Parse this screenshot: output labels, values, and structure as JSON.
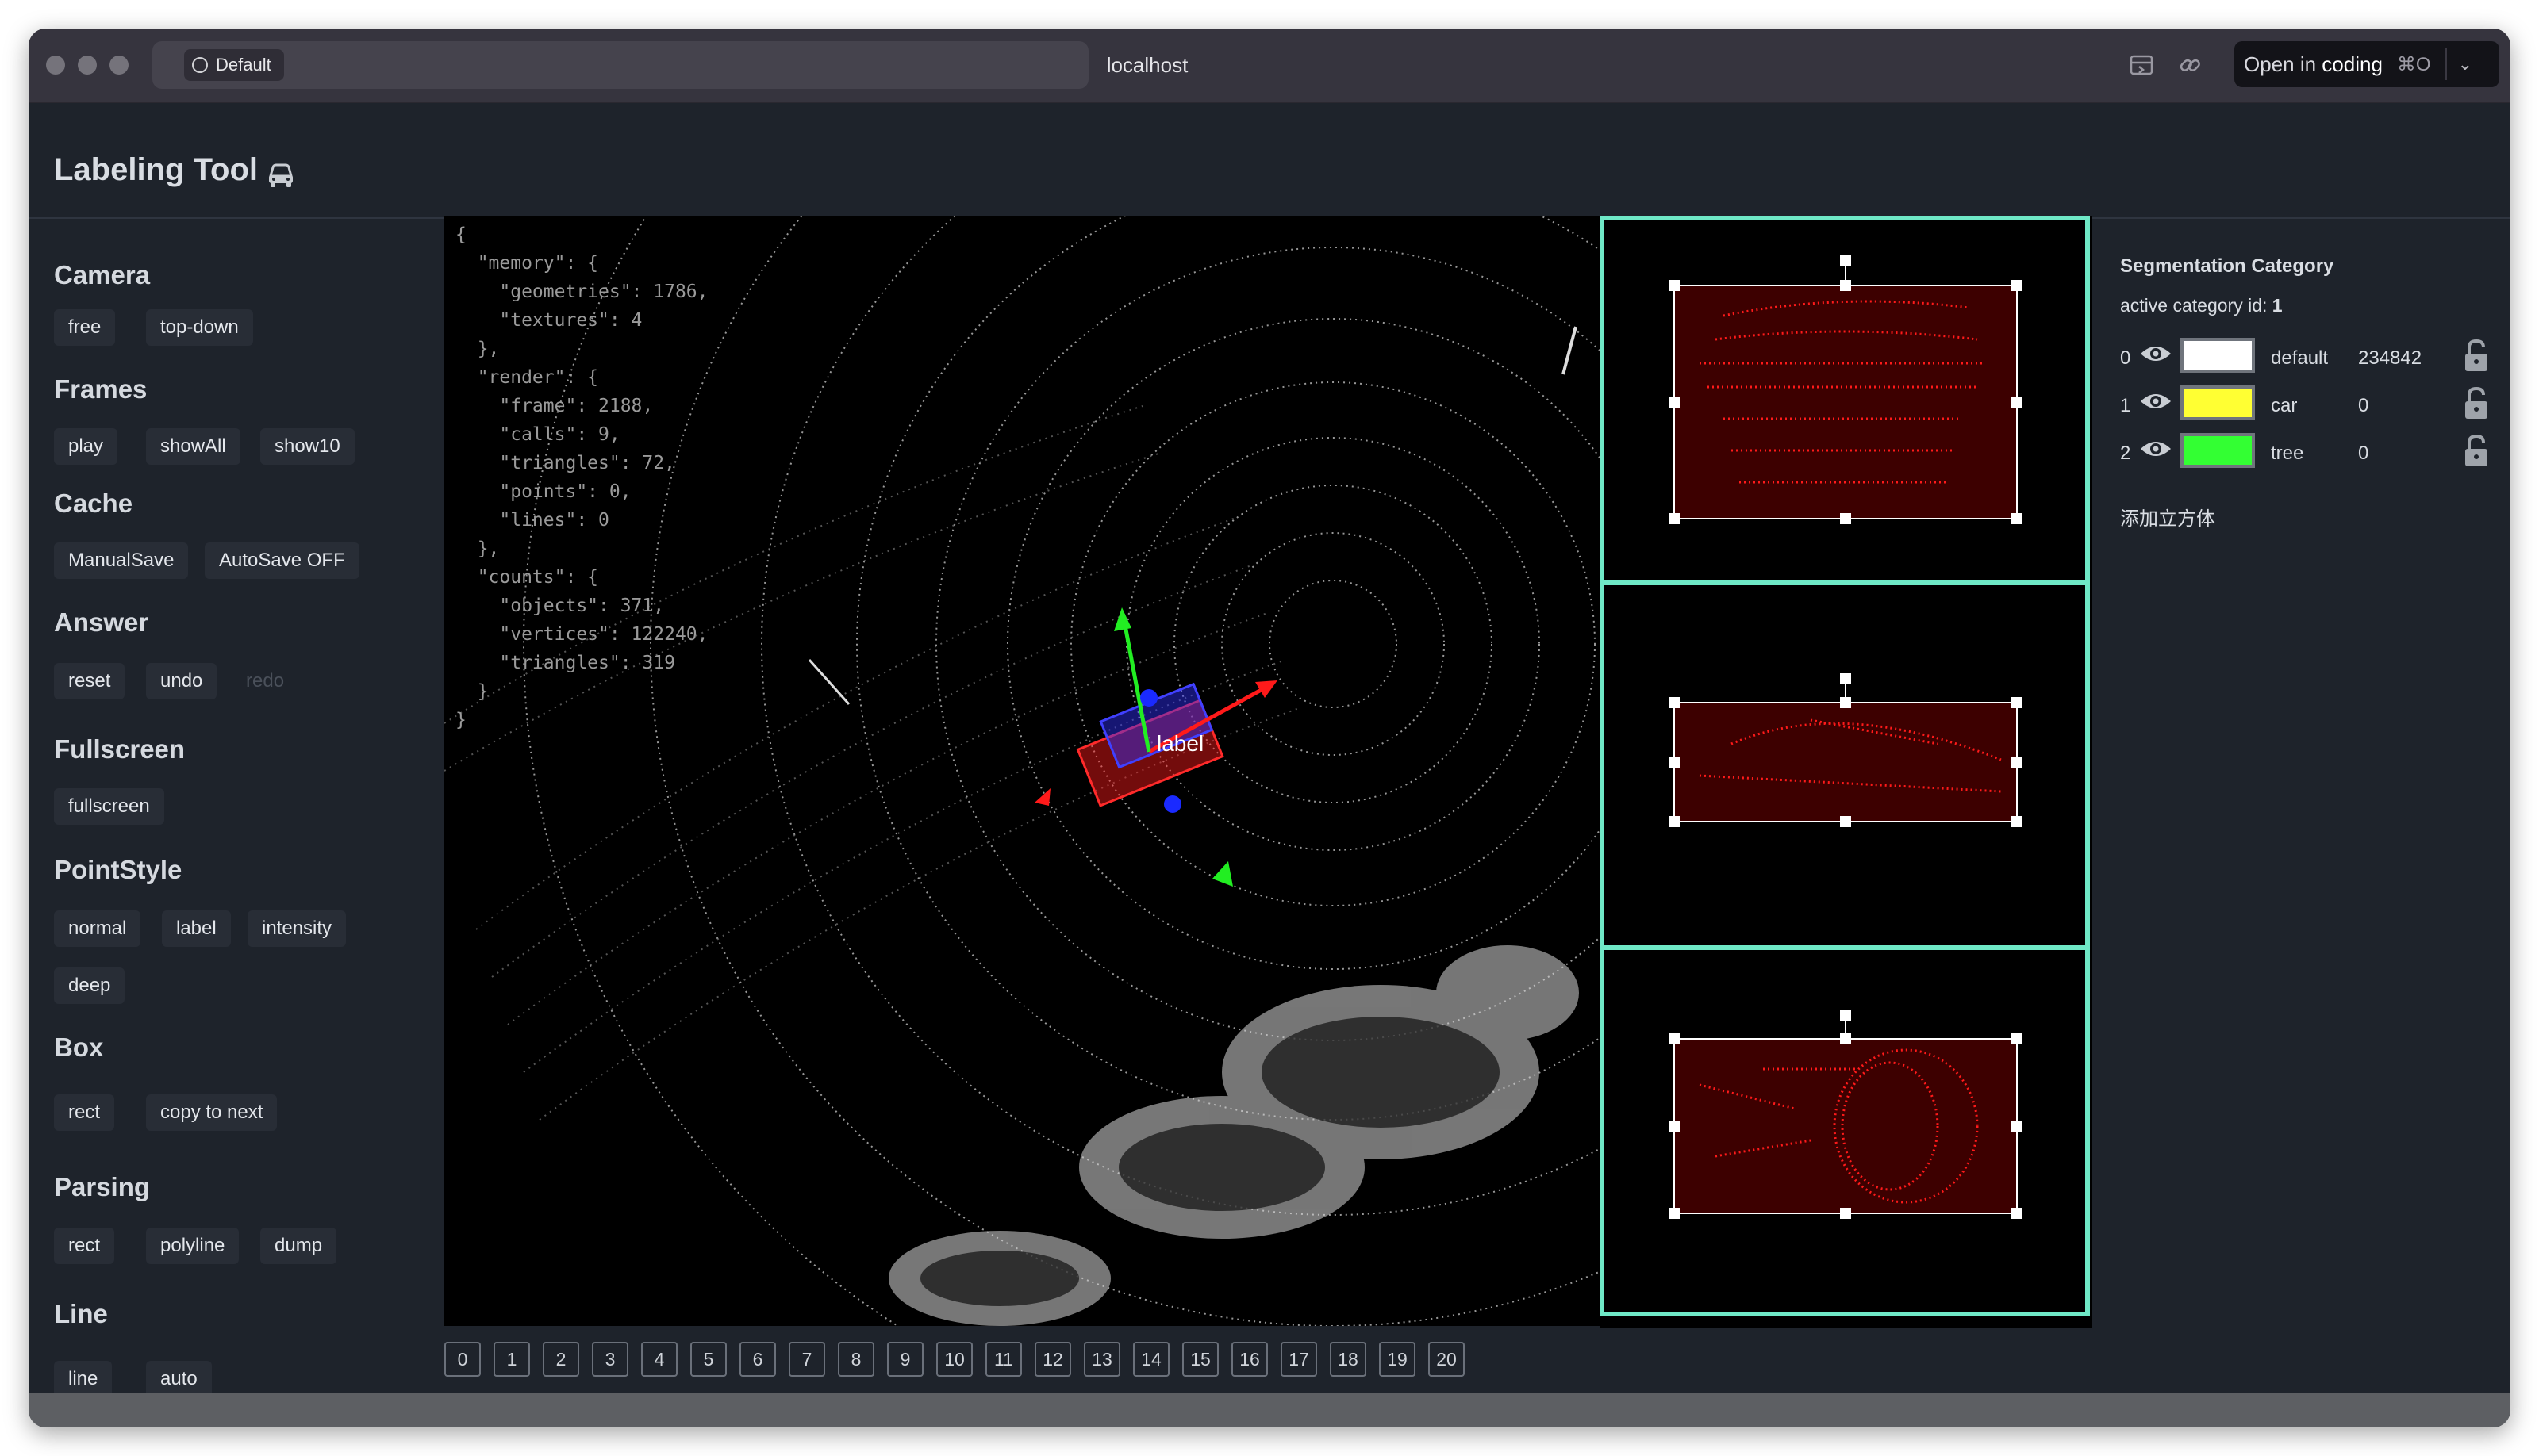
{
  "browser": {
    "profile_label": "Default",
    "url": "localhost",
    "open_button": {
      "prefix": "Open in ",
      "app": "coding",
      "shortcut": "⌘O"
    }
  },
  "app": {
    "title": "Labeling Tool",
    "icon": "car-icon"
  },
  "sidebar": {
    "sections": [
      {
        "title": "Camera",
        "buttons": [
          "free",
          "top-down"
        ]
      },
      {
        "title": "Frames",
        "buttons": [
          "play",
          "showAll",
          "show10"
        ]
      },
      {
        "title": "Cache",
        "buttons": [
          "ManualSave",
          "AutoSave OFF"
        ]
      },
      {
        "title": "Answer",
        "buttons": [
          "reset",
          "undo",
          "redo"
        ],
        "disabled": [
          "redo"
        ]
      },
      {
        "title": "Fullscreen",
        "buttons": [
          "fullscreen"
        ]
      },
      {
        "title": "PointStyle",
        "buttons": [
          "normal",
          "label",
          "intensity",
          "deep"
        ]
      },
      {
        "title": "Box",
        "buttons": [
          "rect",
          "copy to next"
        ]
      },
      {
        "title": "Parsing",
        "buttons": [
          "rect",
          "polyline",
          "dump"
        ]
      },
      {
        "title": "Line",
        "buttons": [
          "line",
          "auto"
        ]
      }
    ]
  },
  "viewport": {
    "stats": "{\n  \"memory\": {\n    \"geometries\": 1786,\n    \"textures\": 4\n  },\n  \"render\": {\n    \"frame\": 2188,\n    \"calls\": 9,\n    \"triangles\": 72,\n    \"points\": 0,\n    \"lines\": 0\n  },\n  \"counts\": {\n    \"objects\": 371,\n    \"vertices\": 122240,\n    \"triangles\": 319\n  }\n}",
    "box_label": "label",
    "accent_color": "#6fe8c6"
  },
  "frames": [
    "0",
    "1",
    "2",
    "3",
    "4",
    "5",
    "6",
    "7",
    "8",
    "9",
    "10",
    "11",
    "12",
    "13",
    "14",
    "15",
    "16",
    "17",
    "18",
    "19",
    "20"
  ],
  "segmentation": {
    "title": "Segmentation Category",
    "active_label": "active category id: ",
    "active_id": "1",
    "categories": [
      {
        "id": "0",
        "name": "default",
        "count": "234842",
        "color": "#ffffff"
      },
      {
        "id": "1",
        "name": "car",
        "count": "0",
        "color": "#ffff33"
      },
      {
        "id": "2",
        "name": "tree",
        "count": "0",
        "color": "#33ff33"
      }
    ],
    "add_cube": "添加立方体"
  }
}
